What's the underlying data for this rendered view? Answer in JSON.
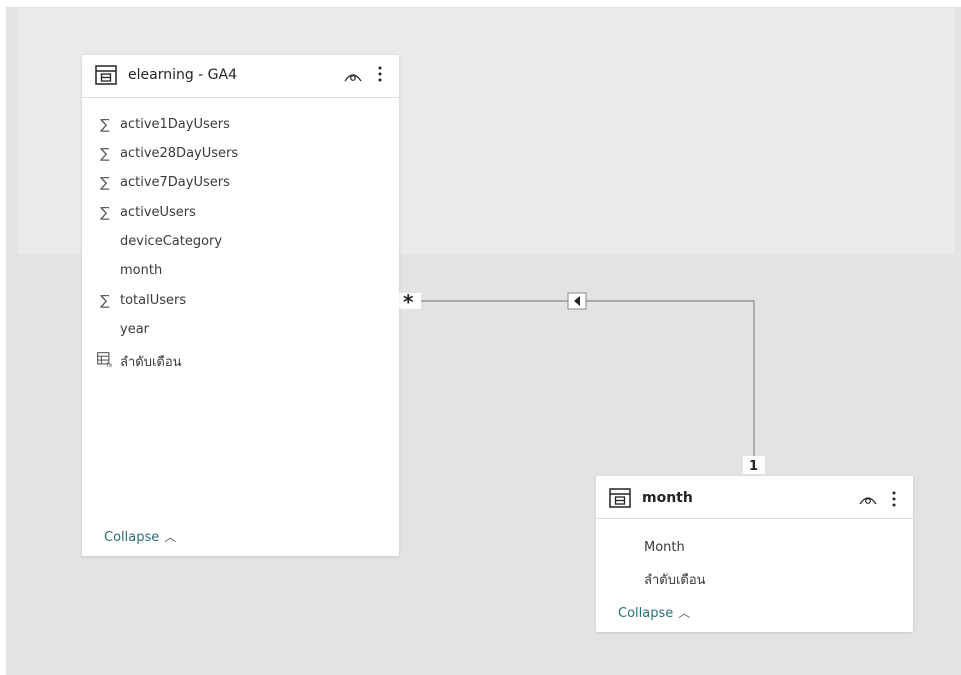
{
  "tables": [
    {
      "name": "elearning - GA4",
      "fields": [
        {
          "icon": "sigma-icon",
          "label": "active1DayUsers"
        },
        {
          "icon": "sigma-icon",
          "label": "active28DayUsers"
        },
        {
          "icon": "sigma-icon",
          "label": "active7DayUsers"
        },
        {
          "icon": "sigma-icon",
          "label": "activeUsers"
        },
        {
          "icon": "",
          "label": "deviceCategory"
        },
        {
          "icon": "",
          "label": "month"
        },
        {
          "icon": "sigma-icon",
          "label": "totalUsers"
        },
        {
          "icon": "",
          "label": "year"
        },
        {
          "icon": "calculated-column-icon",
          "label": "ลำดับเดือน"
        }
      ],
      "collapse_label": "Collapse"
    },
    {
      "name": "month",
      "fields": [
        {
          "icon": "",
          "label": "Month"
        },
        {
          "icon": "",
          "label": "ลำดับเดือน"
        }
      ],
      "collapse_label": "Collapse"
    }
  ],
  "relationship": {
    "from_cardinality": "*",
    "to_cardinality": "1",
    "filter_direction": "single"
  },
  "colors": {
    "link": "#2c6e78",
    "line": "#8a8886",
    "canvas": "#e4e3e1",
    "card": "#ffffff"
  }
}
